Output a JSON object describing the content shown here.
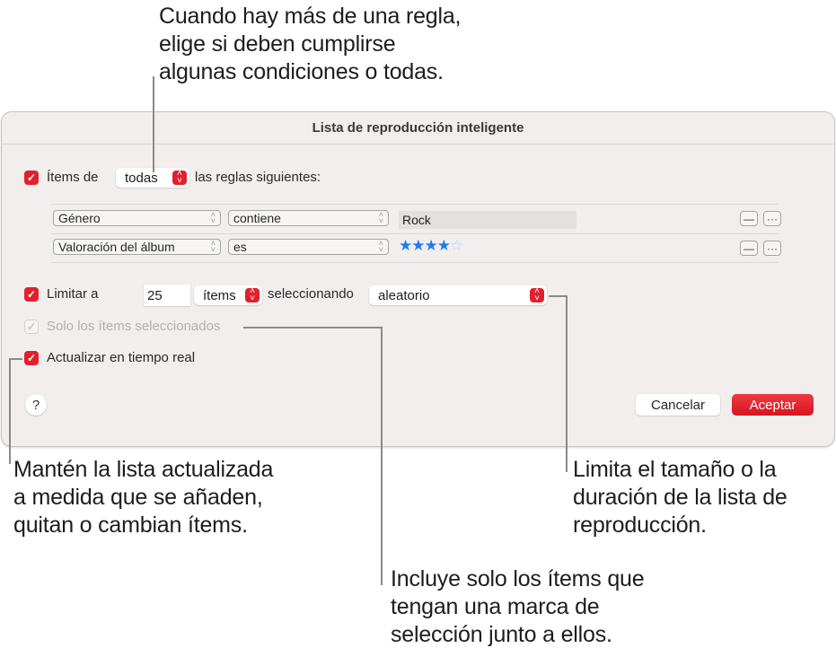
{
  "callouts": {
    "match": "Cuando hay más de una regla,\nelige si deben cumplirse\nalgunas condiciones o todas.",
    "live_update": "Mantén la lista actualizada\na medida que se añaden,\nquitan o cambian ítems.",
    "limit": "Limita el tamaño o la\nduración de la lista de\nreproducción.",
    "checked_only": "Incluye solo los ítems que\ntengan una marca de\nselección junto a ellos."
  },
  "dialog": {
    "title": "Lista de reproducción inteligente",
    "match_row": {
      "checked": true,
      "prefix": "Ítems de",
      "selected": "todas",
      "suffix": "las reglas siguientes:"
    },
    "rules": [
      {
        "field": "Género",
        "operator": "contiene",
        "value": "Rock",
        "remove_label": "—",
        "more_label": "···"
      },
      {
        "field": "Valoración del álbum",
        "operator": "es",
        "rating": 4,
        "rating_max": 5,
        "filled_stars": "★★★★",
        "empty_stars": "☆",
        "remove_label": "—",
        "more_label": "···"
      }
    ],
    "limit": {
      "checked": true,
      "label": "Limitar a",
      "value": "25",
      "unit": "ítems",
      "selecting_label": "seleccionando",
      "method": "aleatorio"
    },
    "checked_only": {
      "checked": true,
      "enabled": false,
      "label": "Solo los ítems seleccionados"
    },
    "live_update": {
      "checked": true,
      "label": "Actualizar en tiempo real"
    },
    "help_label": "?",
    "cancel_label": "Cancelar",
    "ok_label": "Aceptar"
  },
  "colors": {
    "accent": "#e0212d",
    "star": "#1a7cf5",
    "dialog_bg": "#f3eeee"
  }
}
